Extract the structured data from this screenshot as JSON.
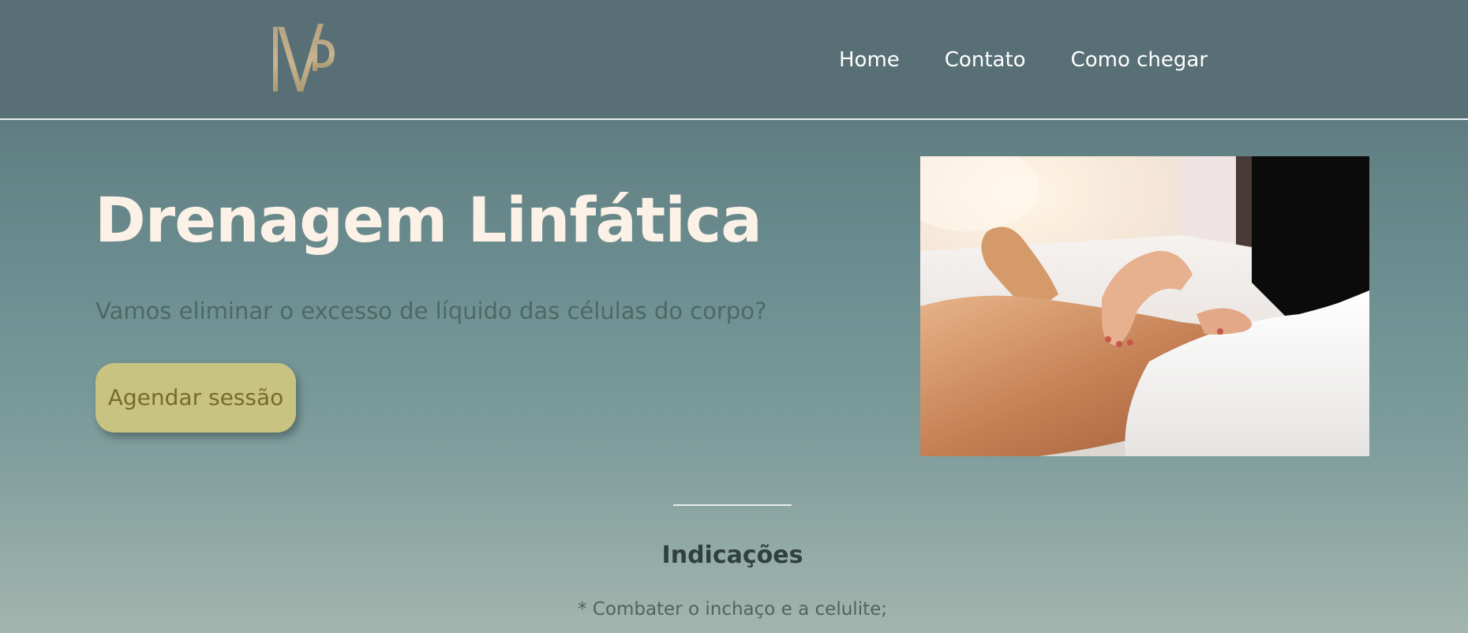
{
  "header": {
    "logo_alt": "NVP monogram logo",
    "nav": [
      {
        "label": "Home"
      },
      {
        "label": "Contato"
      },
      {
        "label": "Como chegar"
      }
    ]
  },
  "hero": {
    "title": "Drenagem Linfática",
    "subtitle": "Vamos eliminar o excesso de líquido das células do corpo?",
    "cta_label": "Agendar sessão",
    "image_alt": "Massage therapist performing leg massage"
  },
  "indicacoes": {
    "title": "Indicações",
    "items": [
      "* Combater o inchaço e a celulite;"
    ]
  },
  "colors": {
    "header_bg": "#586f75",
    "title": "#fbf1e6",
    "cta_bg": "#c9c382",
    "cta_text": "#7a6a2c",
    "logo_gold": "#c0ac86"
  },
  "icons": {
    "logo": "nvp-monogram-logo"
  }
}
